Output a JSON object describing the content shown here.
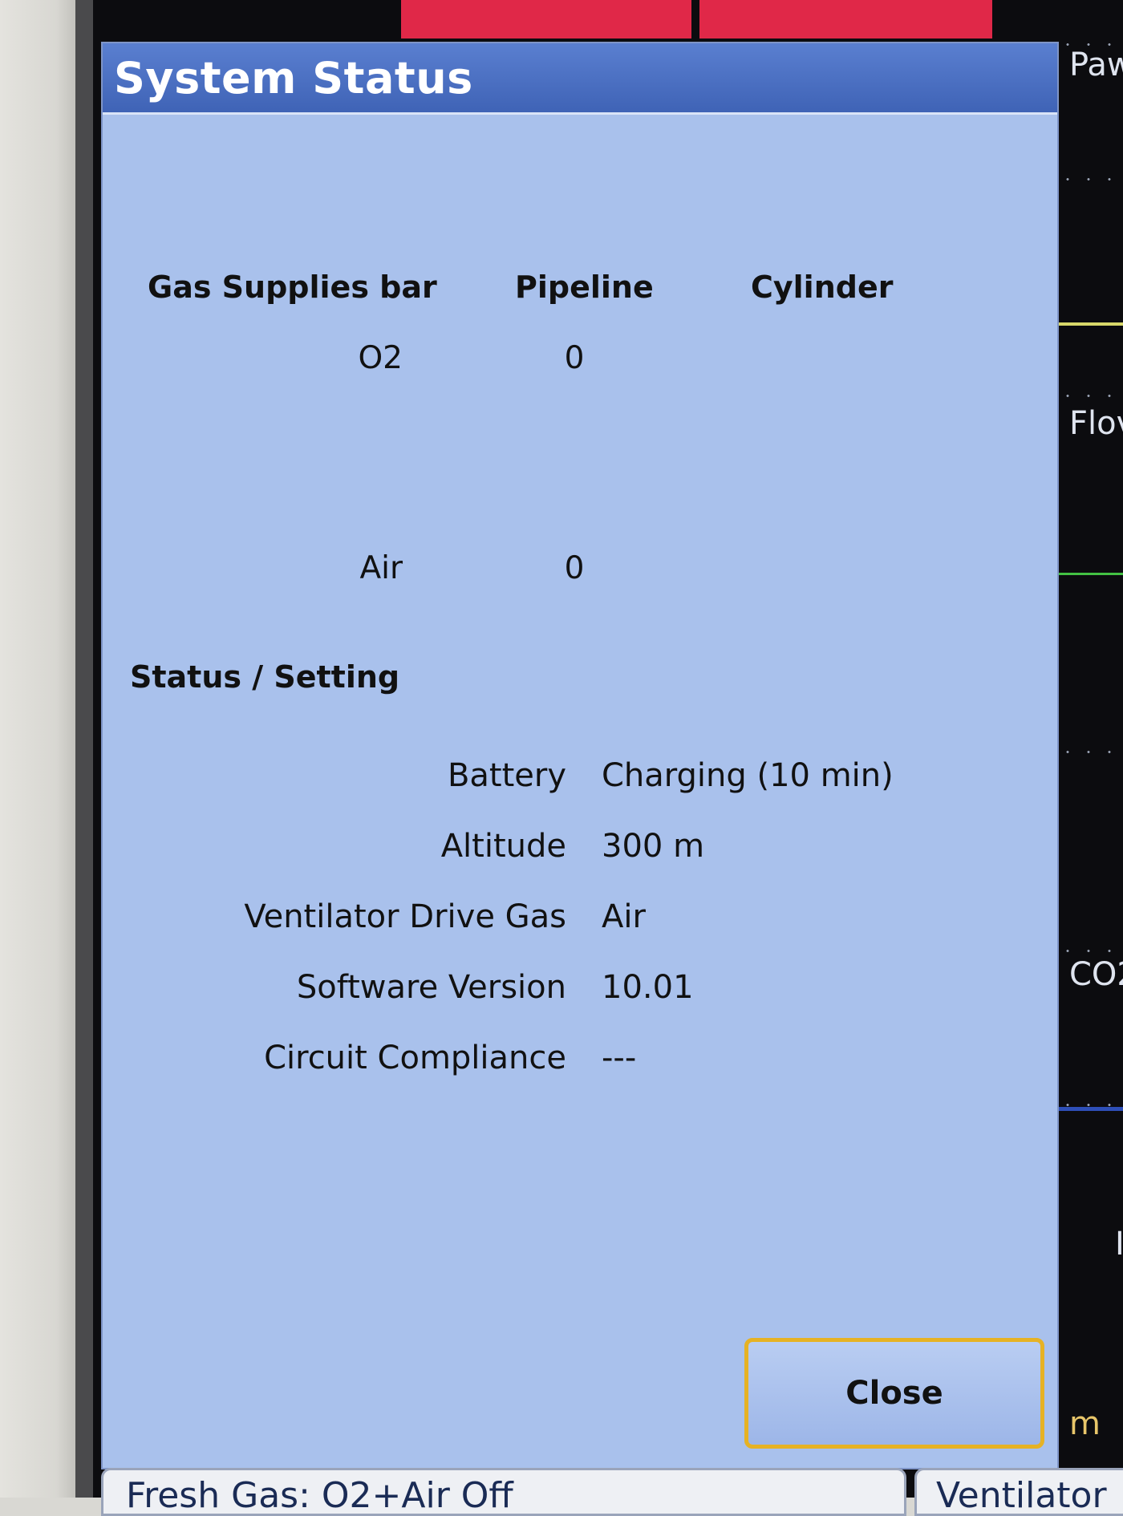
{
  "dialog": {
    "title": "System Status",
    "gas_supplies": {
      "headers": [
        "Gas Supplies bar",
        "Pipeline",
        "Cylinder"
      ],
      "rows": [
        {
          "gas": "O2",
          "pipeline": "0",
          "cylinder": ""
        },
        {
          "gas": "Air",
          "pipeline": "0",
          "cylinder": ""
        }
      ]
    },
    "status_section": {
      "title": "Status / Setting",
      "rows": [
        {
          "label": "Battery",
          "value": "Charging (10 min)"
        },
        {
          "label": "Altitude",
          "value": "300 m"
        },
        {
          "label": "Ventilator Drive Gas",
          "value": "Air"
        },
        {
          "label": "Software Version",
          "value": "10.01"
        },
        {
          "label": "Circuit Compliance",
          "value": "---"
        }
      ]
    },
    "close_label": "Close"
  },
  "background": {
    "waveform_labels": [
      "Paw",
      "Flov",
      "CO2",
      "m"
    ],
    "right_glyph": "I",
    "alarm_color": "#e02848"
  },
  "bottom_tabs": {
    "fresh_gas": "Fresh Gas: O2+Air Off",
    "ventilator": "Ventilator"
  },
  "colors": {
    "dialog_background": "#a9c1ec",
    "header_blue": "#4a6fc3",
    "focus_border": "#e6b224"
  }
}
